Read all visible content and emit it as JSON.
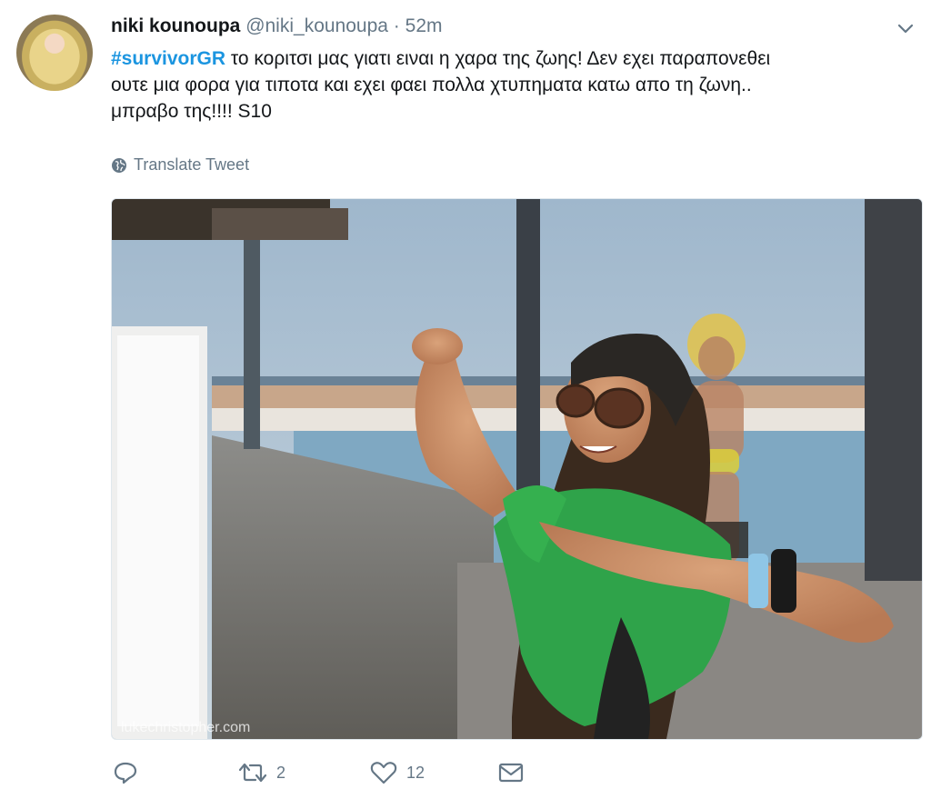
{
  "tweet": {
    "display_name": "niki kounoupa",
    "handle": "@niki_kounoupa",
    "separator": "·",
    "time": "52m",
    "hashtag": "#survivorGR",
    "text_line1": " το κοριτσι μας γιατι ειναι η χαρα της ζωης! Δεν εχει παραπονεθει",
    "text_line2": "ουτε μια φορα για τιποτα και εχει φαει πολλα χτυπηματα κατω απο τη ζωνη..",
    "text_line3": "μπραβο της!!!! S10",
    "translate_label": "Translate Tweet",
    "photo_watermark": "lukechristopher.com"
  },
  "actions": {
    "reply_count": "",
    "retweet_count": "2",
    "like_count": "12"
  },
  "icons": {
    "avatar": "profile-photo",
    "chevron": "chevron-down-icon",
    "translate": "globe-icon",
    "reply": "reply-icon",
    "retweet": "retweet-icon",
    "like": "heart-icon",
    "dm": "envelope-icon"
  },
  "colors": {
    "link": "#1b95e0",
    "muted": "#657786",
    "text": "#14171a"
  }
}
